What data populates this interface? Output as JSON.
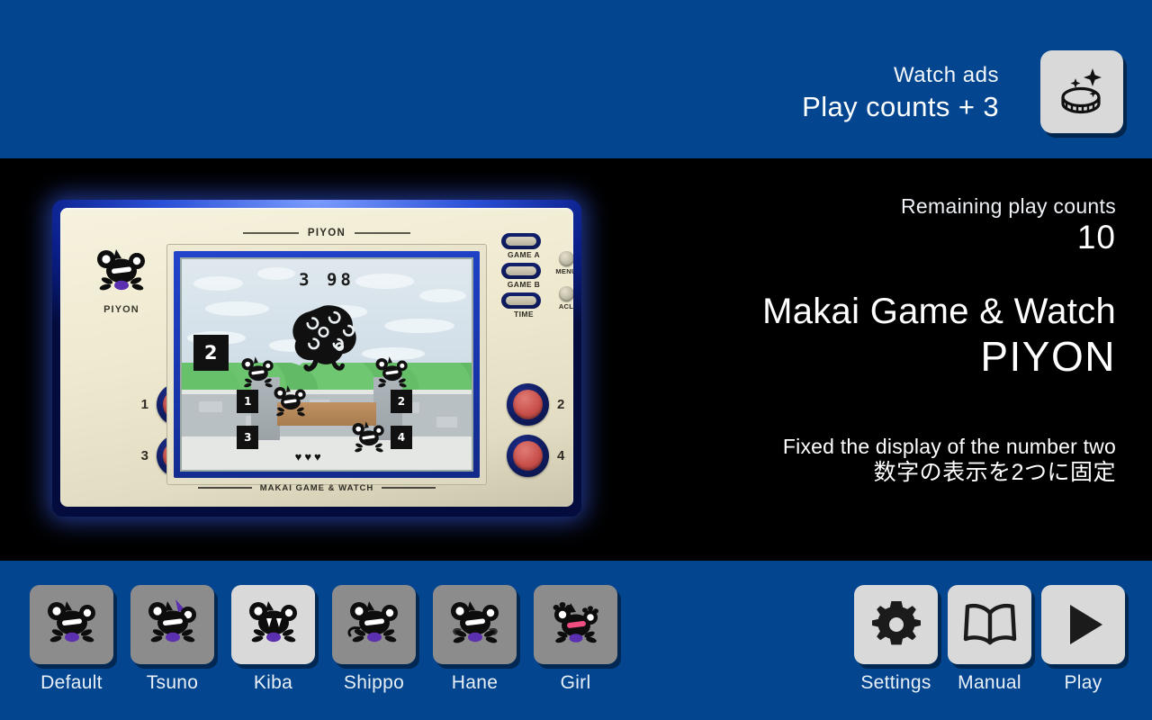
{
  "topbar": {
    "ads_line1": "Watch ads",
    "ads_line2": "Play counts + 3",
    "coin_icon": "coin-sparkle-icon"
  },
  "info": {
    "remaining_label": "Remaining play counts",
    "remaining_value": "10",
    "title_main": "Makai Game & Watch",
    "title_sub": "PIYON",
    "note_en": "Fixed the display of the number two",
    "note_jp": "数字の表示を2つに固定"
  },
  "device": {
    "emblem_name": "PIYON",
    "screen_title": "PIYON",
    "footer_brand": "MAKAI GAME & WATCH",
    "left_buttons": [
      "1",
      "3"
    ],
    "right_buttons": [
      "2",
      "4"
    ],
    "pills": [
      {
        "label": "GAME A"
      },
      {
        "label": "GAME B"
      },
      {
        "label": "TIME"
      }
    ],
    "knobs": [
      {
        "label": "MENU"
      },
      {
        "label": "ACL"
      }
    ],
    "lcd": {
      "score": "3 98",
      "big_number": "2",
      "markers": [
        "1",
        "2",
        "3",
        "4"
      ],
      "hearts": "♥♥♥",
      "heart_count": 3
    }
  },
  "characters": [
    {
      "label": "Default",
      "selected": false
    },
    {
      "label": "Tsuno",
      "selected": false
    },
    {
      "label": "Kiba",
      "selected": true
    },
    {
      "label": "Shippo",
      "selected": false
    },
    {
      "label": "Hane",
      "selected": false
    },
    {
      "label": "Girl",
      "selected": false
    }
  ],
  "actions": [
    {
      "label": "Settings",
      "icon": "gear-icon"
    },
    {
      "label": "Manual",
      "icon": "book-icon"
    },
    {
      "label": "Play",
      "icon": "play-triangle-icon"
    }
  ],
  "colors": {
    "brand_blue": "#03468f",
    "stage_black": "#000000",
    "tile_light": "#d9d9d9",
    "tile_dark": "#8c8c8c",
    "button_red": "#c9504b",
    "accent_purple": "#5a2fb0"
  }
}
